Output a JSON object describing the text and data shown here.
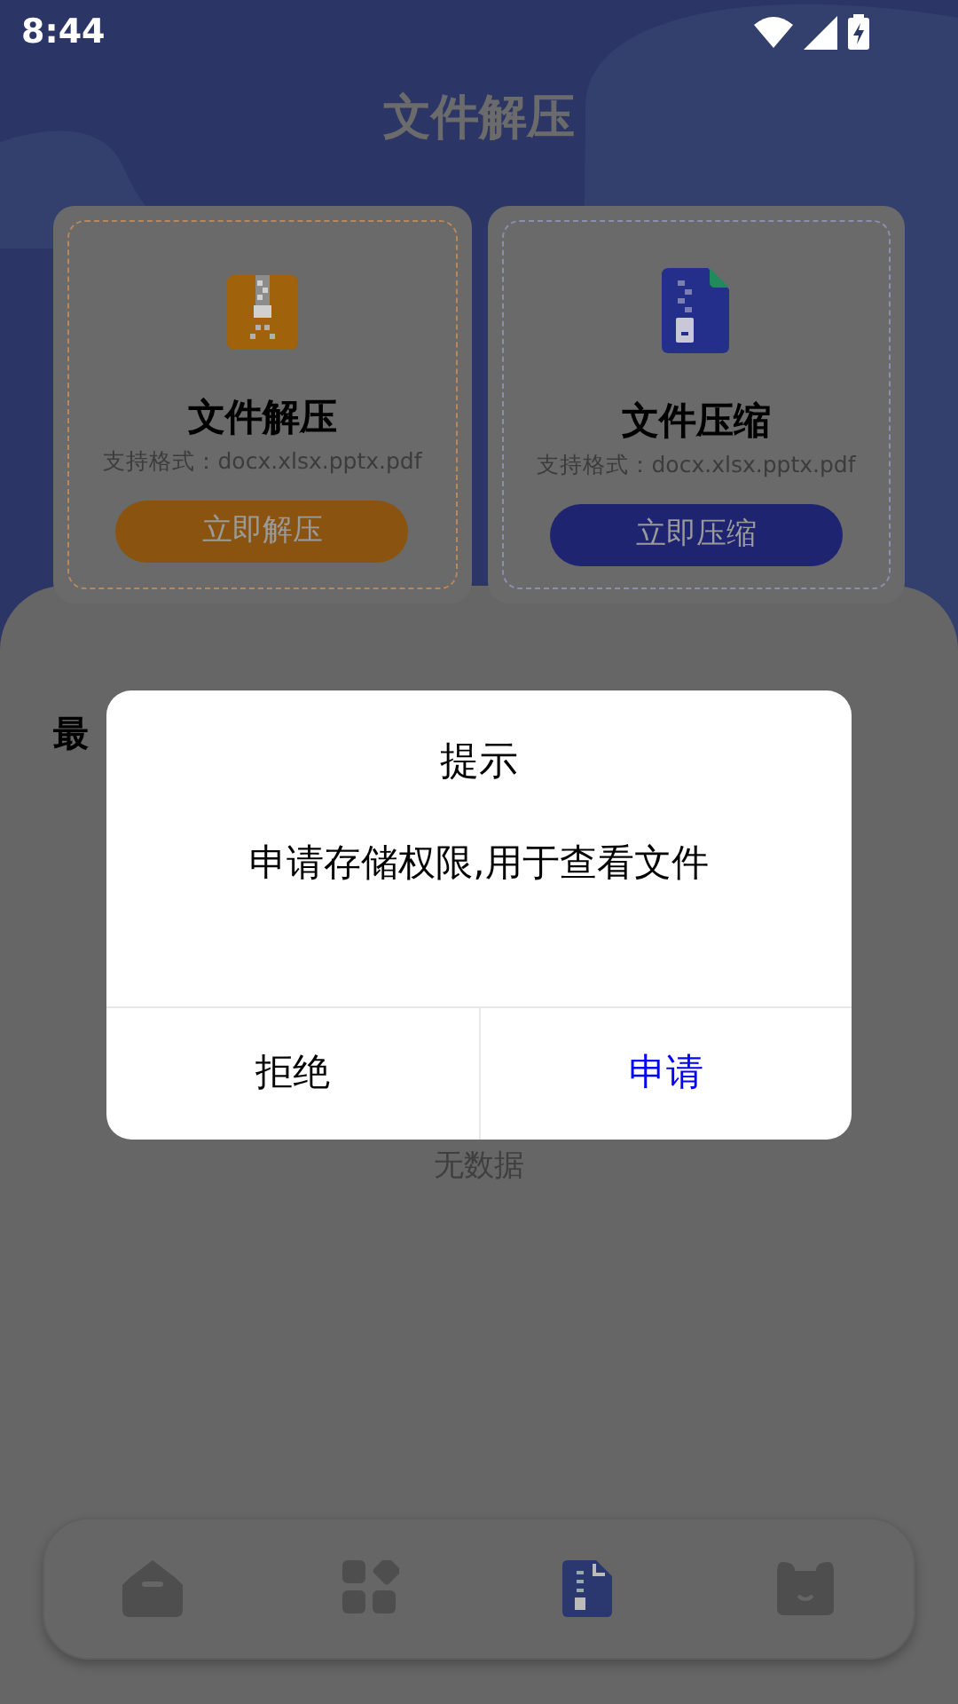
{
  "status_bar": {
    "time": "8:44"
  },
  "header": {
    "title": "文件解压"
  },
  "cards": [
    {
      "kind": "extract",
      "title": "文件解压",
      "formats": "支持格式：docx.xlsx.pptx.pdf",
      "button": "立即解压"
    },
    {
      "kind": "compress",
      "title": "文件压缩",
      "formats": "支持格式：docx.xlsx.pptx.pdf",
      "button": "立即压缩"
    }
  ],
  "recent": {
    "heading": "最",
    "empty": "无数据"
  },
  "bottom_nav": [
    {
      "kind": "box",
      "selected": false
    },
    {
      "kind": "apps",
      "selected": false
    },
    {
      "kind": "zip",
      "selected": true
    },
    {
      "kind": "bear",
      "selected": false
    }
  ],
  "dialog": {
    "title": "提示",
    "message": "申请存储权限,用于查看文件",
    "buttons": [
      {
        "kind": "cancel",
        "label": "拒绝"
      },
      {
        "kind": "confirm",
        "label": "申请"
      }
    ]
  }
}
